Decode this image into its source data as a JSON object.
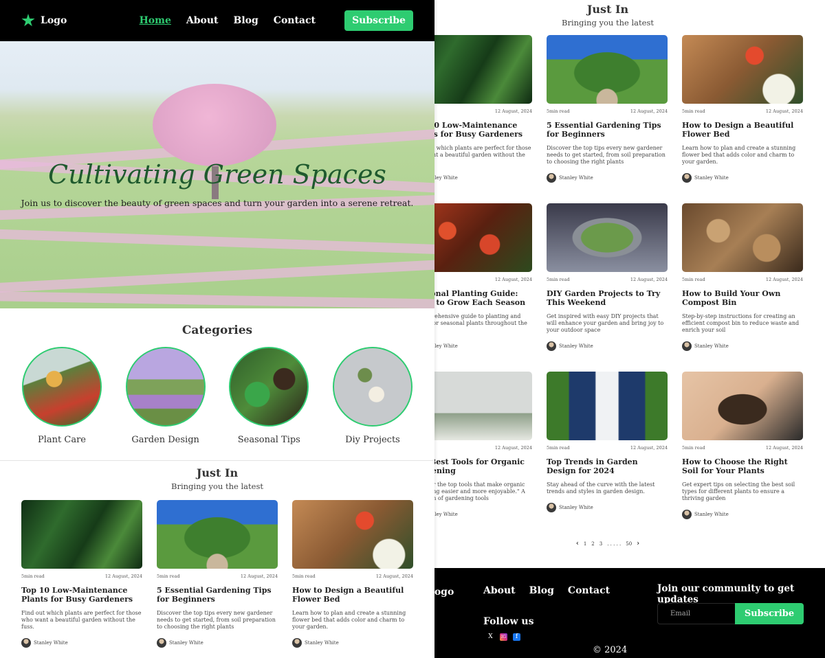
{
  "nav": {
    "logo": "Logo",
    "links": [
      "Home",
      "About",
      "Blog",
      "Contact"
    ],
    "subscribe": "Subscribe"
  },
  "hero": {
    "title": "Cultivating Green Spaces",
    "subtitle": "Join us to discover the beauty of green spaces and turn your garden into a serene retreat."
  },
  "categories": {
    "title": "Categories",
    "items": [
      "Plant Care",
      "Garden Design",
      "Seasonal Tips",
      "Diy Projects"
    ]
  },
  "just_in": {
    "title": "Just In",
    "subtitle": "Bringing you the latest"
  },
  "posts": [
    {
      "read": "5min read",
      "date": "12 August, 2024",
      "title": "Top 10 Low-Maintenance Plants for Busy Gardeners",
      "desc": "Find out which plants are perfect for those who want a beautiful garden without the fuss.",
      "author": "Stanley White",
      "img": "fern"
    },
    {
      "read": "5min read",
      "date": "12 August, 2024",
      "title": "5 Essential Gardening Tips for Beginners",
      "desc": "Discover the top tips every new gardener needs to get started, from soil preparation to choosing the right plants",
      "author": "Stanley White",
      "img": "arch"
    },
    {
      "read": "5min read",
      "date": "12 August, 2024",
      "title": "How to Design a Beautiful Flower Bed",
      "desc": "Learn how to plan and create a stunning flower bed that adds color and charm to your garden.",
      "author": "Stanley White",
      "img": "box"
    },
    {
      "read": "5min read",
      "date": "12 August, 2024",
      "title": "Seasonal Planting Guide: What to Grow Each Season",
      "desc": "A comprehensive guide to planting and caring for seasonal plants throughout the year.",
      "author": "Stanley White",
      "img": "berries"
    },
    {
      "read": "5min read",
      "date": "12 August, 2024",
      "title": "DIY Garden Projects to Try This Weekend",
      "desc": "Get inspired with easy DIY projects that will enhance your garden and bring joy to your outdoor space",
      "author": "Stanley White",
      "img": "model"
    },
    {
      "read": "5min read",
      "date": "12 August, 2024",
      "title": "How to Build Your Own Compost Bin",
      "desc": "Step-by-step instructions for creating an efficient compost bin to reduce waste and enrich your soil",
      "author": "Stanley White",
      "img": "seedlings"
    },
    {
      "read": "5min read",
      "date": "12 August, 2024",
      "title": "The Best Tools for Organic Gardening",
      "desc": "Discover the top tools that make organic gardening easier and more enjoyable.\" A selection of gardening tools",
      "author": "Stanley White",
      "img": "tools"
    },
    {
      "read": "5min read",
      "date": "12 August, 2024",
      "title": "Top Trends in Garden Design for 2024",
      "desc": "Stay ahead of the curve with the latest trends and styles in garden design.",
      "author": "Stanley White",
      "img": "pool"
    },
    {
      "read": "5min read",
      "date": "12 August, 2024",
      "title": "How to Choose the Right Soil for Your Plants",
      "desc": "Get expert tips on selecting the best soil types for different plants to ensure a thriving garden",
      "author": "Stanley White",
      "img": "soil"
    }
  ],
  "pagination": {
    "prev": "‹",
    "pages": [
      "1",
      "2",
      "3"
    ],
    "ellipsis": ". . . . .",
    "last": "50",
    "next": "›"
  },
  "footer": {
    "logo": "Logo",
    "links": [
      "About",
      "Blog",
      "Contact"
    ],
    "follow": "Follow us",
    "social": [
      "X",
      "IG",
      "f"
    ],
    "join": "Join our community to get updates",
    "email_placeholder": "Email",
    "subscribe": "Subscribe",
    "copyright": "© 2024"
  },
  "colors": {
    "accent": "#2ecc71",
    "dark": "#000000",
    "hero_title": "#1f5a2e"
  }
}
